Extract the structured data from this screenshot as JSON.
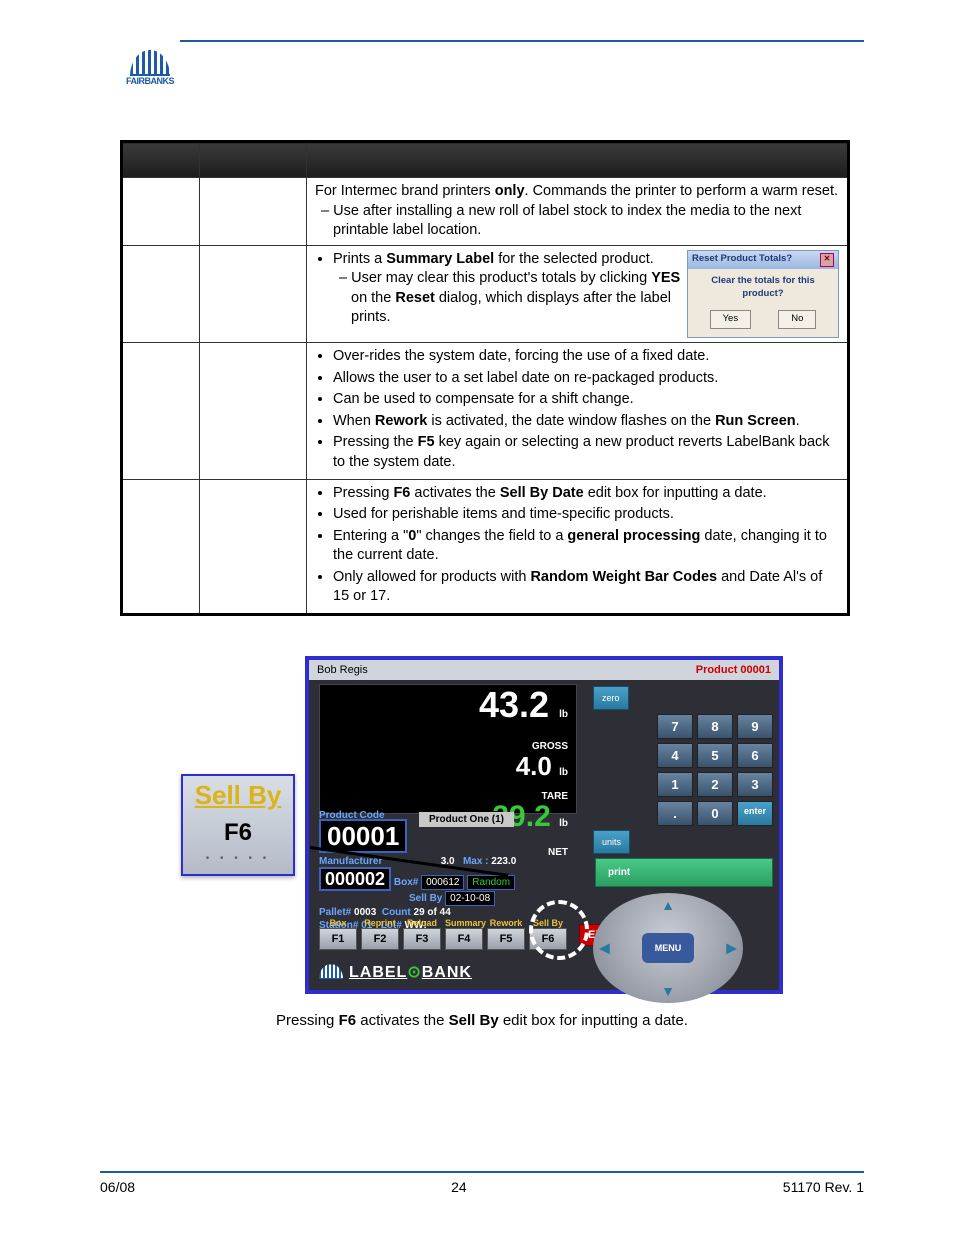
{
  "header": {
    "logo_text": "FAIRBANKS"
  },
  "table": {
    "rows": [
      {
        "desc_parts": [
          "For Intermec brand printers ",
          "only",
          ". Commands the printer to perform a warm reset."
        ],
        "sub": "Use after installing a new roll of label stock to index the media to the next printable label location."
      },
      {
        "bullets": [
          [
            "Prints a ",
            "Summary Label",
            " for the selected product."
          ]
        ],
        "sub_parts": [
          "User may clear this product's totals by clicking ",
          "YES",
          " on the ",
          "Reset",
          " dialog, which displays after the label prints."
        ],
        "dialog": {
          "title": "Reset Product Totals?",
          "message": "Clear the totals for this product?",
          "yes": "Yes",
          "no": "No"
        }
      },
      {
        "bullets": [
          [
            "Over-rides the system date, forcing the use of a fixed date."
          ],
          [
            "Allows the user to a set label date on re-packaged products."
          ],
          [
            "Can be used to compensate for a shift change."
          ],
          [
            "When ",
            "Rework",
            " is activated, the date window flashes on the ",
            "Run Screen",
            "."
          ],
          [
            "Pressing the ",
            "F5",
            " key again or selecting a new product reverts LabelBank back to the system date."
          ]
        ]
      },
      {
        "bullets": [
          [
            "Pressing ",
            "F6",
            " activates the ",
            "Sell By Date",
            " edit box for inputting a date."
          ],
          [
            "Used for perishable items and time-specific products."
          ],
          [
            "Entering a \"",
            "0",
            "\" changes the field to a ",
            "general processing",
            " date, changing it to the current date."
          ],
          [
            "Only allowed for products with ",
            "Random Weight Bar Codes",
            " and Date Al's of 15 or 17."
          ]
        ]
      }
    ]
  },
  "sellby_key": {
    "label_top": "Sell By",
    "label_key": "F6"
  },
  "app": {
    "top_left": "Bob Regis",
    "top_right": "Product 00001",
    "gross_val": "43.2",
    "gross_unit": "lb",
    "gross_lbl": "GROSS",
    "tare_val": "4.0",
    "tare_unit": "lb",
    "tare_lbl": "TARE",
    "net_val": "39.2",
    "net_unit": "lb",
    "net_lbl": "NET",
    "prodcode_lbl": "Product Code",
    "prodcode_val": "00001",
    "proddesc": "Product One (1)",
    "mfg_lbl": "Manufacturer",
    "mfg_val": "000002",
    "tare_small": "3.0",
    "max_lbl": "Max :",
    "max_val": "223.0",
    "box_lbl": "Box#",
    "box_val": "000612",
    "random": "Random",
    "sellby_lbl": "Sell By",
    "sellby_val": "02-10-08",
    "pallet_lbl": "Pallet#",
    "pallet_val": "0003",
    "count_lbl": "Count",
    "count_val": "29 of 44",
    "station_lbl": "Station# 01",
    "lot_lbl": "Lot#",
    "lot_val": "WW!",
    "fkeys": [
      {
        "top": "Box",
        "bottom": "F1"
      },
      {
        "top": "Reprint",
        "bottom": "F2"
      },
      {
        "top": "Reload",
        "bottom": "F3"
      },
      {
        "top": "Summary",
        "bottom": "F4"
      },
      {
        "top": "Rework",
        "bottom": "F5"
      },
      {
        "top": "Sell By",
        "bottom": "F6"
      }
    ],
    "exit": "EXIT",
    "brand1": "LABEL",
    "brand2": "BANK",
    "keypad": [
      "7",
      "8",
      "9",
      "4",
      "5",
      "6",
      "1",
      "2",
      "3",
      ".",
      "0",
      "enter"
    ],
    "side_zero": "zero",
    "side_units": "units",
    "print": "print",
    "menu": "MENU"
  },
  "caption_parts": [
    "Pressing ",
    "F6",
    " activates the ",
    "Sell By",
    " edit box for inputting a date."
  ],
  "footer": {
    "left": "06/08",
    "center": "24",
    "right": "51170    Rev. 1"
  }
}
